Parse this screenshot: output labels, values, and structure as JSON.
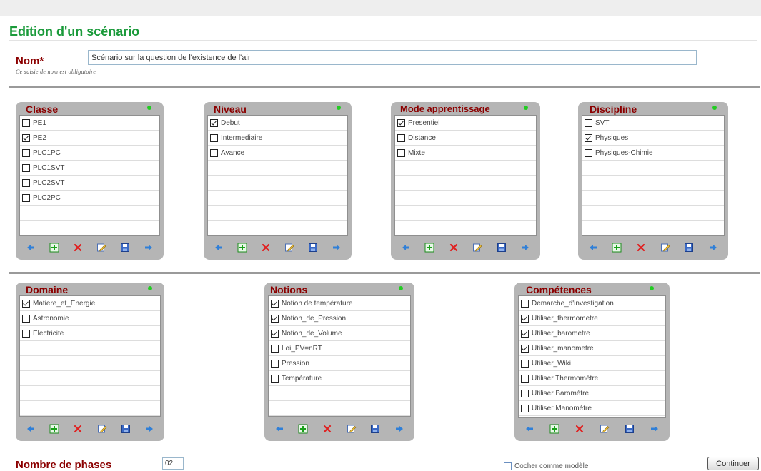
{
  "page": {
    "title": "Edition d'un scénario"
  },
  "nom": {
    "label": "Nom*",
    "value": "Scénario sur la question de l'existence de l'air",
    "hint": "Ce saisie de nom est obligatoire"
  },
  "panels": {
    "classe": {
      "title": "Classe",
      "items": [
        {
          "label": "PE1",
          "checked": false
        },
        {
          "label": "PE2",
          "checked": true
        },
        {
          "label": "PLC1PC",
          "checked": false
        },
        {
          "label": "PLC1SVT",
          "checked": false
        },
        {
          "label": "PLC2SVT",
          "checked": false
        },
        {
          "label": "PLC2PC",
          "checked": false
        }
      ]
    },
    "niveau": {
      "title": "Niveau",
      "items": [
        {
          "label": "Debut",
          "checked": true
        },
        {
          "label": "Intermediaire",
          "checked": false
        },
        {
          "label": "Avance",
          "checked": false
        }
      ]
    },
    "mode": {
      "title": "Mode apprentissage",
      "items": [
        {
          "label": "Presentiel",
          "checked": true
        },
        {
          "label": "Distance",
          "checked": false
        },
        {
          "label": "Mixte",
          "checked": false
        }
      ]
    },
    "discipline": {
      "title": "Discipline",
      "items": [
        {
          "label": "SVT",
          "checked": false
        },
        {
          "label": "Physiques",
          "checked": true
        },
        {
          "label": "Physiques-Chimie",
          "checked": false
        }
      ]
    },
    "domaine": {
      "title": "Domaine",
      "items": [
        {
          "label": "Matiere_et_Energie",
          "checked": true
        },
        {
          "label": "Astronomie",
          "checked": false
        },
        {
          "label": "Electricite",
          "checked": false
        }
      ]
    },
    "notions": {
      "title": "Notions",
      "items": [
        {
          "label": "Notion de température",
          "checked": true
        },
        {
          "label": "Notion_de_Pression",
          "checked": true
        },
        {
          "label": "Notion_de_Volume",
          "checked": true
        },
        {
          "label": "Loi_PV=nRT",
          "checked": false
        },
        {
          "label": "Pression",
          "checked": false
        },
        {
          "label": "Température",
          "checked": false
        }
      ]
    },
    "competences": {
      "title": "Compétences",
      "items": [
        {
          "label": "Demarche_d'investigation",
          "checked": false
        },
        {
          "label": "Utiliser_thermometre",
          "checked": true
        },
        {
          "label": "Utiliser_barometre",
          "checked": true
        },
        {
          "label": "Utiliser_manometre",
          "checked": true
        },
        {
          "label": "Utiliser_Wiki",
          "checked": false
        },
        {
          "label": "Utiliser Thermomètre",
          "checked": false
        },
        {
          "label": "Utiliser Baromètre",
          "checked": false
        },
        {
          "label": "Utiliser Manomètre",
          "checked": false
        }
      ]
    }
  },
  "toolbar_icons": [
    "arrow-left-icon",
    "add-icon",
    "delete-icon",
    "edit-icon",
    "save-icon",
    "arrow-right-icon"
  ],
  "colors": {
    "title_green": "#1a9a3a",
    "label_red": "#8b0000",
    "panel_gray": "#b5b5b5",
    "status_dot": "#22cc22"
  },
  "footer": {
    "phases_label": "Nombre de phases",
    "phases_value": "02",
    "model_checkbox_label": "Cocher comme modèle",
    "continue_label": "Continuer"
  }
}
